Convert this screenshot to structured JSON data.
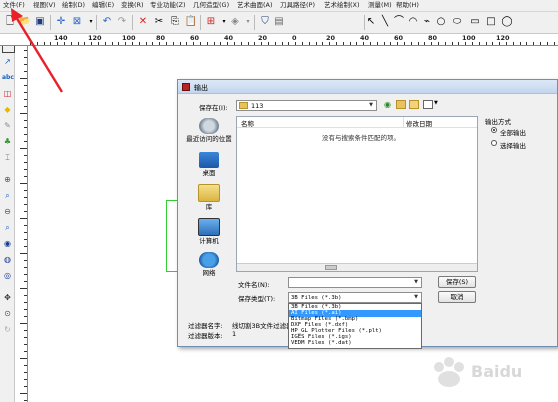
{
  "menu": [
    "文件(F)",
    "视图(V)",
    "绘制(D)",
    "编辑(E)",
    "变换(R)",
    "专业功能(Z)",
    "几何造型(G)",
    "艺术曲面(A)",
    "刀具路径(P)",
    "艺术绘制(X)",
    "测量(M)",
    "帮助(H)"
  ],
  "ruler": {
    "top_labels": [
      "140",
      "120",
      "100",
      "80",
      "60",
      "40",
      "20",
      "0",
      "20",
      "40",
      "60",
      "80",
      "100",
      "120"
    ]
  },
  "dialog": {
    "title": "输出",
    "save_in_label": "保存在(I):",
    "save_in_value": "113",
    "columns": {
      "name": "名称",
      "date": "修改日期"
    },
    "empty_message": "没有与搜索条件匹配的项。",
    "places": [
      {
        "label": "最近访问的位置",
        "icon": "recent-places-icon"
      },
      {
        "label": "桌面",
        "icon": "desktop-icon"
      },
      {
        "label": "库",
        "icon": "libraries-icon"
      },
      {
        "label": "计算机",
        "icon": "computer-icon"
      },
      {
        "label": "网络",
        "icon": "network-icon"
      }
    ],
    "filename_label": "文件名(N):",
    "filename_value": "",
    "filetype_label": "保存类型(T):",
    "filetype_value": "3B Files (*.3b)",
    "filetype_options": [
      "3B Files (*.3b)",
      "AI Files (*.ai)",
      "Bitmap Files (*.bmp)",
      "DXF Files (*.dxf)",
      "HP_GL Plotter Files (*.plt)",
      "IGES Files (*.igs)",
      "VEDM Files (*.dat)"
    ],
    "selected_option_index": 1,
    "save_button": "保存(S)",
    "cancel_button": "取消",
    "output_mode": {
      "title": "输出方式",
      "options": [
        "全部输出",
        "选择输出"
      ],
      "selected_index": 0
    },
    "filter_name_label": "过滤器名字:",
    "filter_name_value": "线切割3B文件过滤器",
    "filter_version_label": "过滤器版本:",
    "filter_version_value": "1"
  },
  "colors": {
    "annotation_arrow": "#e8202a",
    "selection_highlight": "#3399ff",
    "canvas_shape": "#33cc33"
  }
}
